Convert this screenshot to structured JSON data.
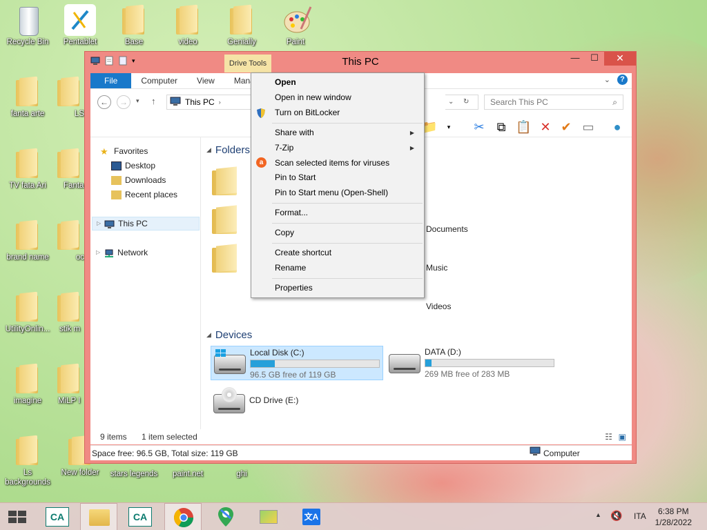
{
  "desktop": {
    "icons": [
      {
        "label": "Recycle Bin"
      },
      {
        "label": "Pentablet"
      },
      {
        "label": "Base"
      },
      {
        "label": "video"
      },
      {
        "label": "Genially"
      },
      {
        "label": "Paint"
      },
      {
        "label": "fanta arte"
      },
      {
        "label": "LS"
      },
      {
        "label": "TV fata Ari"
      },
      {
        "label": "Fanta"
      },
      {
        "label": "brand name"
      },
      {
        "label": "oc"
      },
      {
        "label": "UtilityOnlin..."
      },
      {
        "label": "stik m"
      },
      {
        "label": "imagine"
      },
      {
        "label": "MiLP I"
      },
      {
        "label": "Ls backgrounds"
      },
      {
        "label": "New folder"
      },
      {
        "label": "stars legends"
      },
      {
        "label": "paint.net"
      },
      {
        "label": "ghi"
      }
    ]
  },
  "window": {
    "title": "This PC",
    "contextual_tab": "Drive Tools",
    "controls": {
      "minimize": "—",
      "maximize": "☐",
      "close": "✕"
    },
    "tabs": [
      {
        "label": "File"
      },
      {
        "label": "Computer"
      },
      {
        "label": "View"
      },
      {
        "label": "Mana"
      }
    ],
    "address": "This PC",
    "search_placeholder": "Search This PC",
    "nav_pane": {
      "favorites": "Favorites",
      "items": [
        "Desktop",
        "Downloads",
        "Recent places"
      ],
      "this_pc": "This PC",
      "network": "Network"
    },
    "sections": {
      "folders": "Folders",
      "devices": "Devices"
    },
    "folders": [
      "Documents",
      "Music",
      "Videos"
    ],
    "drives": [
      {
        "name": "Local Disk (C:)",
        "free": "96.5 GB free of 119 GB",
        "used_pct": 19,
        "selected": true
      },
      {
        "name": "DATA (D:)",
        "free": "269 MB free of 283 MB",
        "used_pct": 5,
        "selected": false
      },
      {
        "name": "CD Drive (E:)"
      }
    ],
    "status": {
      "items": "9 items",
      "selected": "1 item selected"
    },
    "details": {
      "space": "Space free: 96.5 GB, Total size: 119 GB",
      "location": "Computer"
    }
  },
  "context_menu": {
    "items": [
      {
        "label": "Open",
        "bold": true
      },
      {
        "label": "Open in new window"
      },
      {
        "label": "Turn on BitLocker"
      },
      {
        "label": "Share with",
        "submenu": true
      },
      {
        "label": "7-Zip",
        "submenu": true
      },
      {
        "label": "Scan selected items for viruses"
      },
      {
        "label": "Pin to Start"
      },
      {
        "label": "Pin to Start menu (Open-Shell)"
      },
      {
        "label": "Format..."
      },
      {
        "label": "Copy"
      },
      {
        "label": "Create shortcut"
      },
      {
        "label": "Rename"
      },
      {
        "label": "Properties"
      }
    ]
  },
  "taskbar": {
    "language": "ITA",
    "time": "6:38 PM",
    "date": "1/28/2022"
  }
}
